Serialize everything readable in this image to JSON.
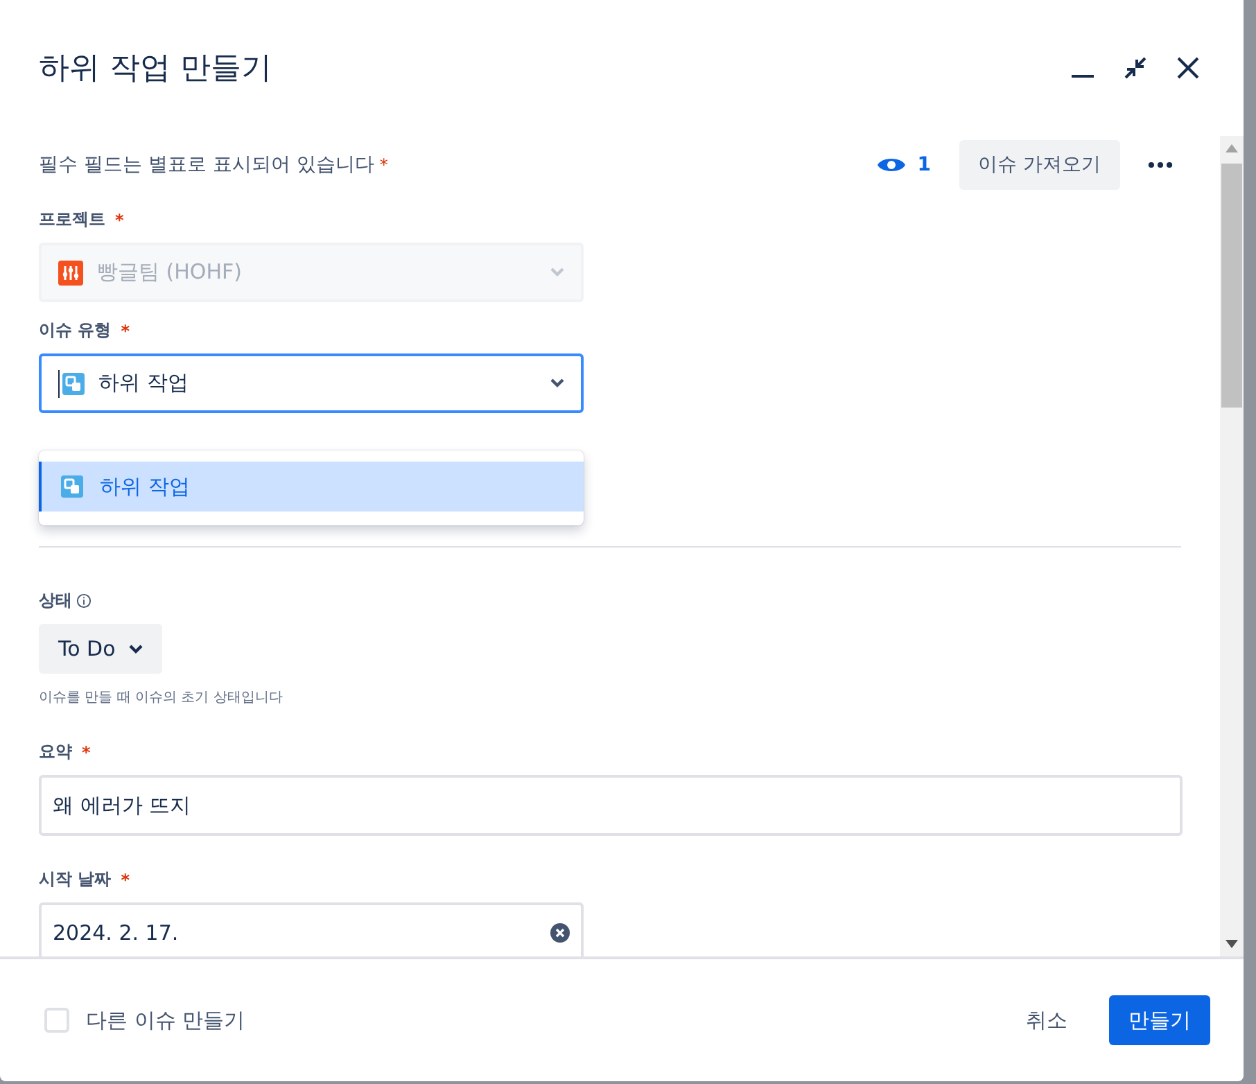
{
  "dialog": {
    "title": "하위 작업 만들기"
  },
  "required_note": {
    "text": "필수 필드는 별표로 표시되어 있습니다",
    "mark": "*"
  },
  "watchers": {
    "count": "1"
  },
  "import_button": "이슈 가져오기",
  "project": {
    "label": "프로젝트",
    "mark": "*",
    "value": "빵글팀 (HOHF)",
    "disabled": true
  },
  "issue_type": {
    "label": "이슈 유형",
    "mark": "*",
    "value": "하위 작업",
    "focused": true,
    "expanded": true,
    "options": [
      {
        "label": "하위 작업",
        "selected": true
      }
    ]
  },
  "status": {
    "label": "상태",
    "value": "To Do",
    "help": "이슈를 만들 때 이슈의 초기 상태입니다"
  },
  "summary": {
    "label": "요약",
    "mark": "*",
    "value": "왜 에러가 뜨지"
  },
  "start_date": {
    "label": "시작 날짜",
    "mark": "*",
    "value": "2024. 2. 17."
  },
  "footer": {
    "another": {
      "label": "다른 이슈 만들기",
      "checked": false
    },
    "cancel": "취소",
    "create": "만들기"
  }
}
